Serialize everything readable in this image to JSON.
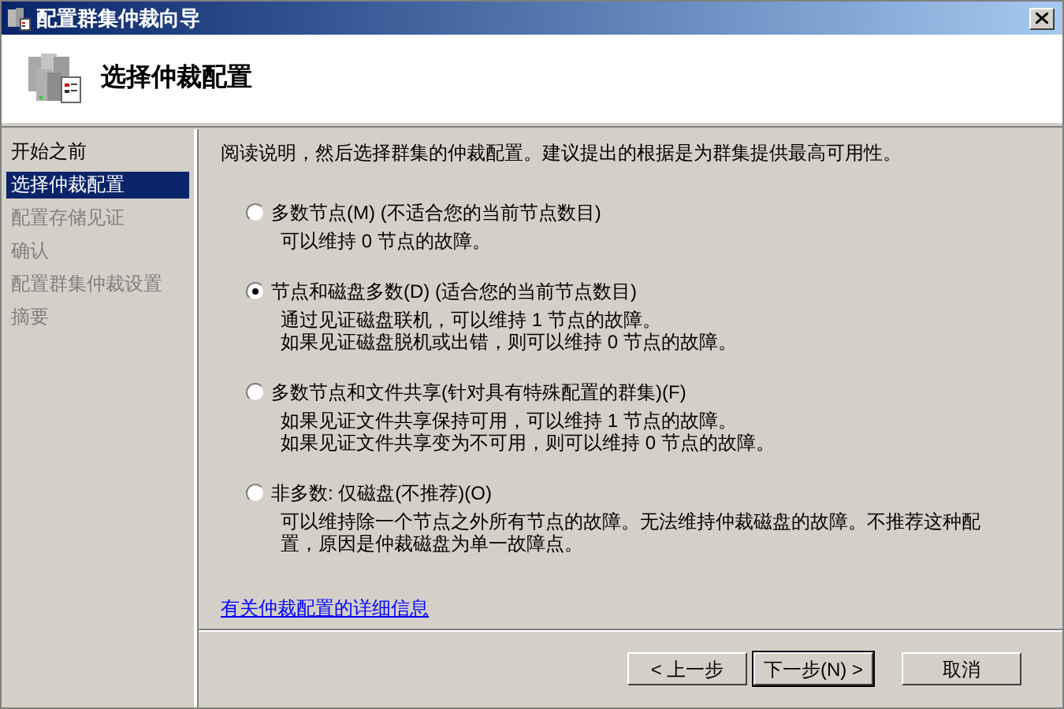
{
  "window": {
    "title": "配置群集仲裁向导"
  },
  "header": {
    "title": "选择仲裁配置"
  },
  "sidebar": {
    "items": [
      {
        "label": "开始之前",
        "selected": false,
        "disabled": false
      },
      {
        "label": "选择仲裁配置",
        "selected": true,
        "disabled": false
      },
      {
        "label": "配置存储见证",
        "selected": false,
        "disabled": true
      },
      {
        "label": "确认",
        "selected": false,
        "disabled": true
      },
      {
        "label": "配置群集仲裁设置",
        "selected": false,
        "disabled": true
      },
      {
        "label": "摘要",
        "selected": false,
        "disabled": true
      }
    ]
  },
  "intro": "阅读说明，然后选择群集的仲裁配置。建议提出的根据是为群集提供最高可用性。",
  "options": [
    {
      "label": "多数节点(M) (不适合您的当前节点数目)",
      "selected": false,
      "description": [
        "可以维持 0 节点的故障。"
      ]
    },
    {
      "label": "节点和磁盘多数(D) (适合您的当前节点数目)",
      "selected": true,
      "description": [
        "通过见证磁盘联机，可以维持 1 节点的故障。",
        "如果见证磁盘脱机或出错，则可以维持 0 节点的故障。"
      ]
    },
    {
      "label": "多数节点和文件共享(针对具有特殊配置的群集)(F)",
      "selected": false,
      "description": [
        "如果见证文件共享保持可用，可以维持 1 节点的故障。",
        "如果见证文件共享变为不可用，则可以维持 0 节点的故障。"
      ]
    },
    {
      "label": "非多数: 仅磁盘(不推荐)(O)",
      "selected": false,
      "description": [
        "可以维持除一个节点之外所有节点的故障。无法维持仲裁磁盘的故障。不推荐这种配",
        "置，原因是仲裁磁盘为单一故障点。"
      ]
    }
  ],
  "link": "有关仲裁配置的详细信息",
  "buttons": [
    {
      "label": "< 上一步",
      "default": false
    },
    {
      "label": "下一步(N) >",
      "default": true
    },
    {
      "label": "取消",
      "default": false
    }
  ]
}
